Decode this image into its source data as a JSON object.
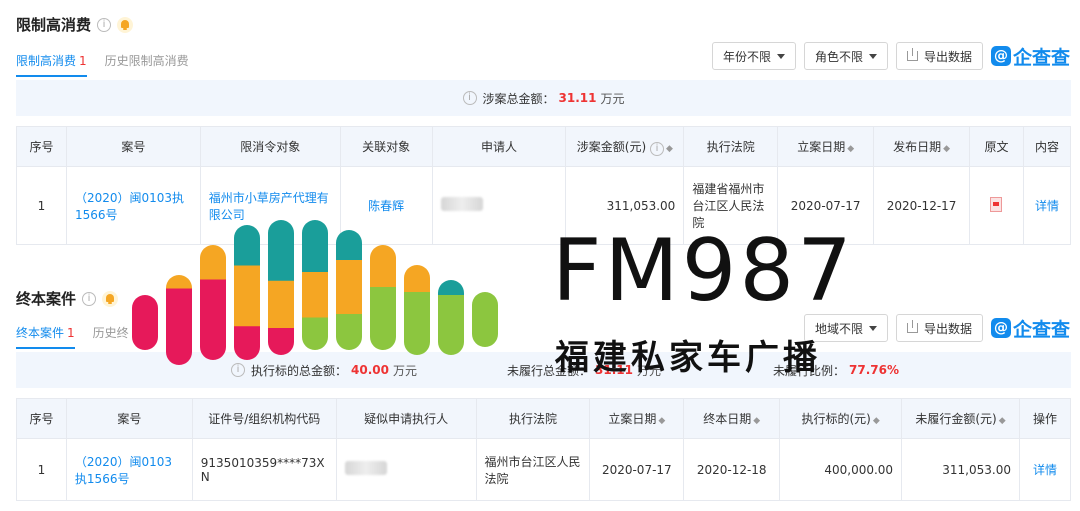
{
  "section1": {
    "title": "限制高消费",
    "tabs": [
      {
        "label": "限制高消费",
        "count": "1"
      },
      {
        "label": "历史限制高消费",
        "count": ""
      }
    ],
    "filters": [
      "年份不限",
      "角色不限"
    ],
    "export_label": "导出数据",
    "logo_text": "企查查",
    "summary": {
      "label": "涉案总金额：",
      "amount": "31.11",
      "unit": "万元"
    },
    "columns": [
      "序号",
      "案号",
      "限消令对象",
      "关联对象",
      "申请人",
      "涉案金额(元)",
      "执行法院",
      "立案日期",
      "发布日期",
      "原文",
      "内容"
    ],
    "rows": [
      {
        "no": "1",
        "case_no": "（2020）闽0103执1566号",
        "target": "福州市小草房产代理有限公司",
        "related": "陈春辉",
        "amount": "311,053.00",
        "court": "福建省福州市台江区人民法院",
        "filed": "2020-07-17",
        "published": "2020-12-17",
        "detail": "详情"
      }
    ]
  },
  "section2": {
    "title": "终本案件",
    "tabs": [
      {
        "label": "终本案件",
        "count": "1"
      },
      {
        "label": "历史终",
        "count": ""
      }
    ],
    "filters": [
      "地域不限"
    ],
    "export_label": "导出数据",
    "logo_text": "企查查",
    "summary": {
      "exec_label": "执行标的总金额：",
      "exec_amount": "40.00",
      "exec_unit": "万元",
      "unpaid_label": "未履行总金额：",
      "unpaid_amount": "31.11",
      "unpaid_unit": "万元",
      "ratio_label": "未履行比例：",
      "ratio": "77.76%"
    },
    "columns": [
      "序号",
      "案号",
      "证件号/组织机构代码",
      "疑似申请执行人",
      "执行法院",
      "立案日期",
      "终本日期",
      "执行标的(元)",
      "未履行金额(元)",
      "操作"
    ],
    "rows": [
      {
        "no": "1",
        "case_no": "（2020）闽0103执1566号",
        "id_code": "9135010359****73XN",
        "court": "福州市台江区人民法院",
        "filed": "2020-07-17",
        "ended": "2020-12-18",
        "exec_amount": "400,000.00",
        "unpaid": "311,053.00",
        "detail": "详情"
      }
    ]
  },
  "watermark": {
    "title": "FM987",
    "subtitle": "福建私家车广播",
    "colors": [
      "#e6195a",
      "#f5a623",
      "#1a9e9a",
      "#8cc63f"
    ]
  }
}
